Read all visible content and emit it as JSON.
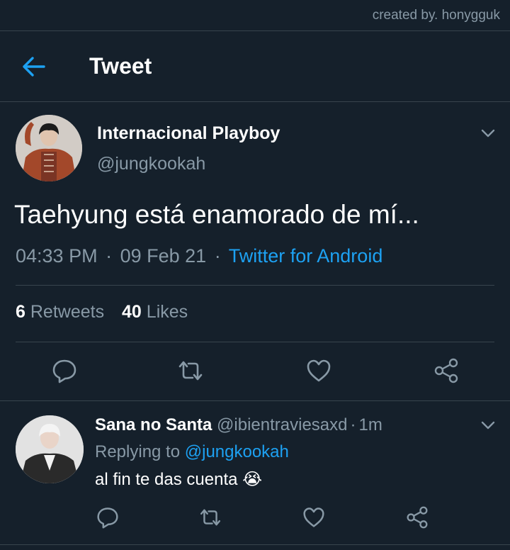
{
  "watermark": "created by. honygguk",
  "header": {
    "title": "Tweet"
  },
  "tweet": {
    "author_name": "Internacional Playboy",
    "author_handle": "@jungkookah",
    "text": "Taehyung está enamorado de mí...",
    "time": "04:33 PM",
    "date": "09 Feb 21",
    "separator": "·",
    "source": "Twitter for Android",
    "retweets_count": "6",
    "retweets_label": "Retweets",
    "likes_count": "40",
    "likes_label": "Likes"
  },
  "reply": {
    "author_name": "Sana no Santa",
    "author_handle": "@ibientraviesaxd",
    "time_ago": "1m",
    "replying_to_label": "Replying to",
    "replying_to_handle": "@jungkookah",
    "text": "al fin te das cuenta 😭"
  },
  "colors": {
    "background": "#15202b",
    "accent": "#1da1f2",
    "muted": "#8899a6",
    "divider": "#38444d"
  },
  "icons": [
    "arrow-left-icon",
    "chevron-down-icon",
    "reply-icon",
    "retweet-icon",
    "heart-icon",
    "share-icon"
  ]
}
